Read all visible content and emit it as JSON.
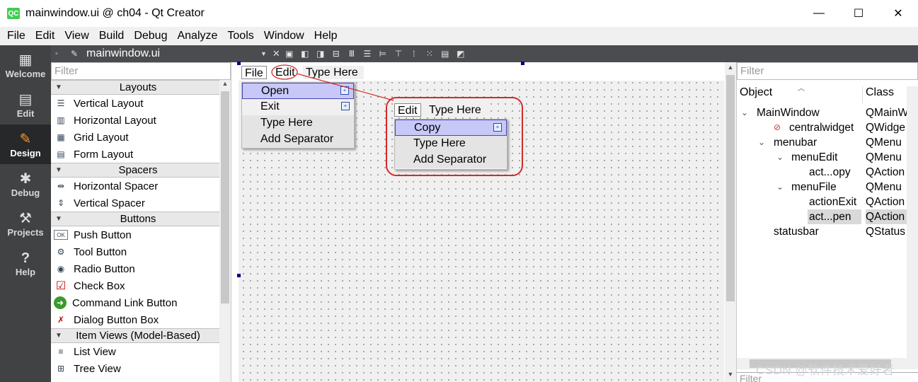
{
  "window": {
    "title": "mainwindow.ui @ ch04 - Qt Creator",
    "app_icon": "QC",
    "minimize": "—",
    "maximize": "☐",
    "close": "✕"
  },
  "menubar": [
    "File",
    "Edit",
    "View",
    "Build",
    "Debug",
    "Analyze",
    "Tools",
    "Window",
    "Help"
  ],
  "modes": [
    {
      "label": "Welcome",
      "icon": "grid-icon",
      "glyph": "▦"
    },
    {
      "label": "Edit",
      "icon": "document-icon",
      "glyph": "▤"
    },
    {
      "label": "Design",
      "icon": "pencil-icon",
      "glyph": "✎"
    },
    {
      "label": "Debug",
      "icon": "bug-icon",
      "glyph": "✱"
    },
    {
      "label": "Projects",
      "icon": "wrench-icon",
      "glyph": "⚒"
    },
    {
      "label": "Help",
      "icon": "help-icon",
      "glyph": "?"
    }
  ],
  "active_mode": "Design",
  "editor_toolbar": {
    "file_name": "mainwindow.ui"
  },
  "widget_box": {
    "filter_placeholder": "Filter",
    "categories": [
      {
        "name": "Layouts",
        "items": [
          {
            "label": "Vertical Layout",
            "icon": "vertical-layout-icon",
            "glyph": "☰"
          },
          {
            "label": "Horizontal Layout",
            "icon": "horizontal-layout-icon",
            "glyph": "▥"
          },
          {
            "label": "Grid Layout",
            "icon": "grid-layout-icon",
            "glyph": "▦"
          },
          {
            "label": "Form Layout",
            "icon": "form-layout-icon",
            "glyph": "▤"
          }
        ]
      },
      {
        "name": "Spacers",
        "items": [
          {
            "label": "Horizontal Spacer",
            "icon": "horizontal-spacer-icon",
            "glyph": "⇹"
          },
          {
            "label": "Vertical Spacer",
            "icon": "vertical-spacer-icon",
            "glyph": "⇕"
          }
        ]
      },
      {
        "name": "Buttons",
        "items": [
          {
            "label": "Push Button",
            "icon": "push-button-icon",
            "glyph": "OK"
          },
          {
            "label": "Tool Button",
            "icon": "tool-button-icon",
            "glyph": "⚙"
          },
          {
            "label": "Radio Button",
            "icon": "radio-button-icon",
            "glyph": "◉"
          },
          {
            "label": "Check Box",
            "icon": "check-box-icon",
            "glyph": "☑"
          },
          {
            "label": "Command Link Button",
            "icon": "command-link-icon",
            "glyph": "➜"
          },
          {
            "label": "Dialog Button Box",
            "icon": "dialog-button-box-icon",
            "glyph": "✗"
          }
        ]
      },
      {
        "name": "Item Views (Model-Based)",
        "items": [
          {
            "label": "List View",
            "icon": "list-view-icon",
            "glyph": "≡"
          },
          {
            "label": "Tree View",
            "icon": "tree-view-icon",
            "glyph": "⊞"
          }
        ]
      }
    ]
  },
  "form": {
    "menubar": [
      "File",
      "Edit",
      "Type Here"
    ],
    "file_menu": [
      {
        "label": "Open",
        "highlighted": true,
        "submenu": true
      },
      {
        "label": "Exit",
        "highlighted": false,
        "submenu": true
      },
      {
        "label": "Type Here",
        "highlighted": false,
        "submenu": false
      },
      {
        "label": "Add Separator",
        "highlighted": false,
        "submenu": false
      }
    ],
    "edit_menubar": [
      "Edit",
      "Type Here"
    ],
    "edit_menu": [
      {
        "label": "Copy",
        "highlighted": true,
        "submenu": true
      },
      {
        "label": "Type Here",
        "highlighted": false,
        "submenu": false
      },
      {
        "label": "Add Separator",
        "highlighted": false,
        "submenu": false
      }
    ]
  },
  "object_inspector": {
    "filter_placeholder": "Filter",
    "columns": [
      "Object",
      "Class"
    ],
    "rows": [
      {
        "object": "MainWindow",
        "class": "QMainW",
        "depth": 0,
        "expander": "⌄"
      },
      {
        "object": "centralwidget",
        "class": "QWidge",
        "depth": 1,
        "expander": "",
        "icon": "no-layout-icon"
      },
      {
        "object": "menubar",
        "class": "QMenu",
        "depth": 1,
        "expander": "⌄"
      },
      {
        "object": "menuEdit",
        "class": "QMenu",
        "depth": 2,
        "expander": "⌄"
      },
      {
        "object": "act...opy",
        "class": "QAction",
        "depth": 3,
        "expander": ""
      },
      {
        "object": "menuFile",
        "class": "QMenu",
        "depth": 2,
        "expander": "⌄"
      },
      {
        "object": "actionExit",
        "class": "QAction",
        "depth": 3,
        "expander": ""
      },
      {
        "object": "act...pen",
        "class": "QAction",
        "depth": 3,
        "expander": "",
        "selected": true
      },
      {
        "object": "statusbar",
        "class": "QStatus",
        "depth": 1,
        "expander": ""
      }
    ],
    "property_filter_placeholder": "Filter"
  },
  "watermark": "CSDN @软件技术爱好者",
  "colors": {
    "mode_bar": "#404244",
    "active_mode_icon": "#f39c35",
    "menu_highlight": "#c8c8f8",
    "annotation_red": "#d42a2a"
  }
}
